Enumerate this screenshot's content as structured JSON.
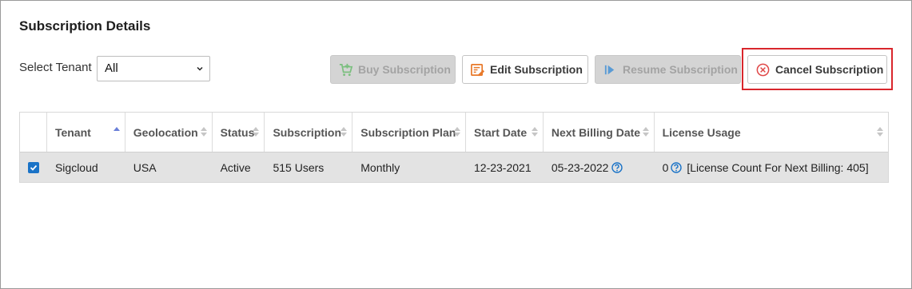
{
  "title": "Subscription Details",
  "tenant_filter": {
    "label": "Select Tenant",
    "selected": "All"
  },
  "toolbar": {
    "buy": {
      "label": "Buy Subscription",
      "icon": "cart-plus-icon",
      "enabled": false
    },
    "edit": {
      "label": "Edit Subscription",
      "icon": "edit-list-icon",
      "enabled": true
    },
    "resume": {
      "label": "Resume Subscription",
      "icon": "play-icon",
      "enabled": false
    },
    "cancel": {
      "label": "Cancel Subscription",
      "icon": "cancel-circle-icon",
      "enabled": true,
      "highlighted": true
    }
  },
  "colors": {
    "accent": "#1a73c7",
    "highlight": "#d9262c",
    "cancel_icon": "#e04848",
    "edit_icon": "#e8792a",
    "buy_icon": "#3aa34a"
  },
  "table": {
    "columns": [
      "Tenant",
      "Geolocation",
      "Status",
      "Subscription",
      "Subscription Plan",
      "Start Date",
      "Next Billing Date",
      "License Usage"
    ],
    "sorted_column": "Tenant",
    "sort_direction": "ascending",
    "rows": [
      {
        "selected": true,
        "tenant": "Sigcloud",
        "geolocation": "USA",
        "status": "Active",
        "subscription": "515 Users",
        "plan": "Monthly",
        "start_date": "12-23-2021",
        "next_billing_date": "05-23-2022",
        "license_count": "0",
        "license_note": "[License Count For Next Billing: 405]"
      }
    ]
  }
}
